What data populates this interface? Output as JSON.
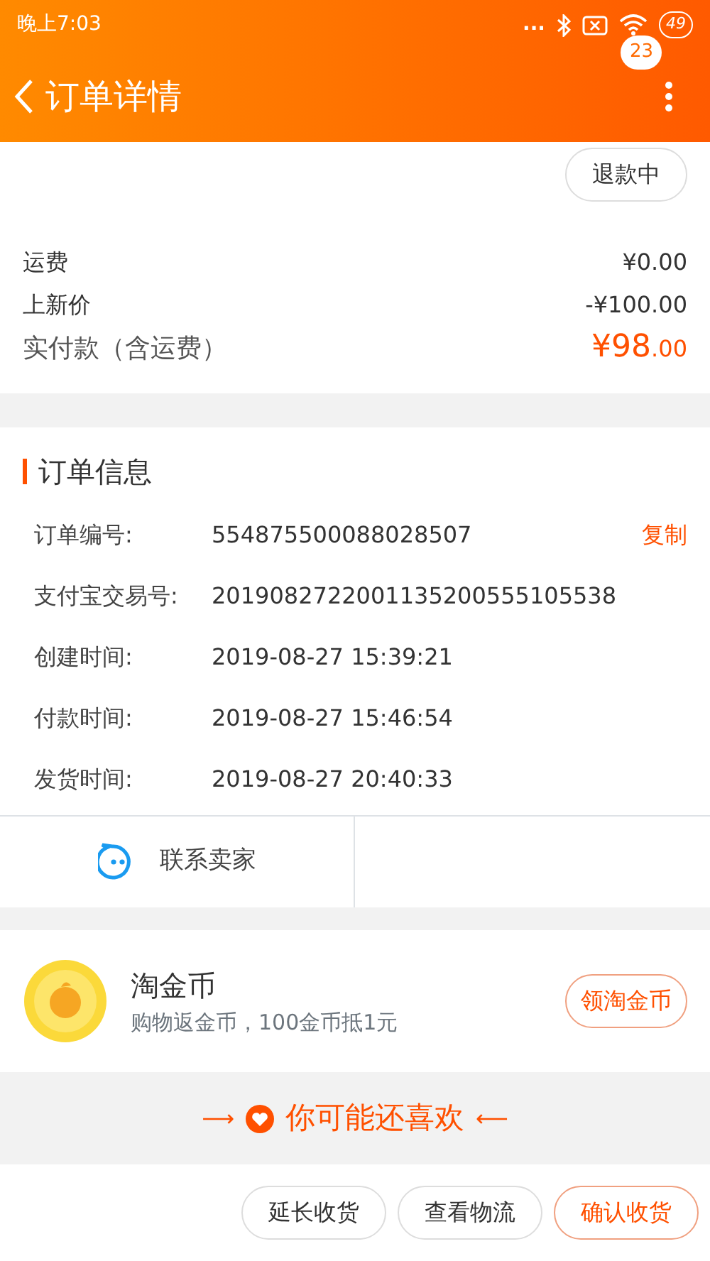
{
  "status_bar": {
    "time": "晚上7:03",
    "dots": "...",
    "battery": "49"
  },
  "nav": {
    "title": "订单详情",
    "badge": "23"
  },
  "refund_button": "退款中",
  "price_rows": [
    {
      "label": "运费",
      "value": "¥0.00",
      "kind": "plain"
    },
    {
      "label": "上新价",
      "value": "-¥100.00",
      "kind": "plain"
    },
    {
      "label": "实付款（含运费）",
      "value": "¥98",
      "cents": ".00",
      "kind": "total"
    }
  ],
  "order_info": {
    "title": "订单信息",
    "rows": [
      {
        "label": "订单编号:",
        "value": "554875500088028507",
        "action": "复制"
      },
      {
        "label": "支付宝交易号:",
        "value": "2019082722001135200555105538"
      },
      {
        "label": "创建时间:",
        "value": "2019-08-27 15:39:21"
      },
      {
        "label": "付款时间:",
        "value": "2019-08-27 15:46:54"
      },
      {
        "label": "发货时间:",
        "value": "2019-08-27 20:40:33"
      }
    ]
  },
  "contact_seller": "联系卖家",
  "coins": {
    "title": "淘金币",
    "subtitle": "购物返金币，100金币抵1元",
    "button": "领淘金币"
  },
  "recommend": {
    "arrow_left": "⟶",
    "title": "你可能还喜欢",
    "arrow_right": "⟵"
  },
  "bottom_buttons": [
    {
      "label": "延长收货",
      "kind": "plain"
    },
    {
      "label": "查看物流",
      "kind": "plain"
    },
    {
      "label": "确认收货",
      "kind": "primary"
    }
  ]
}
